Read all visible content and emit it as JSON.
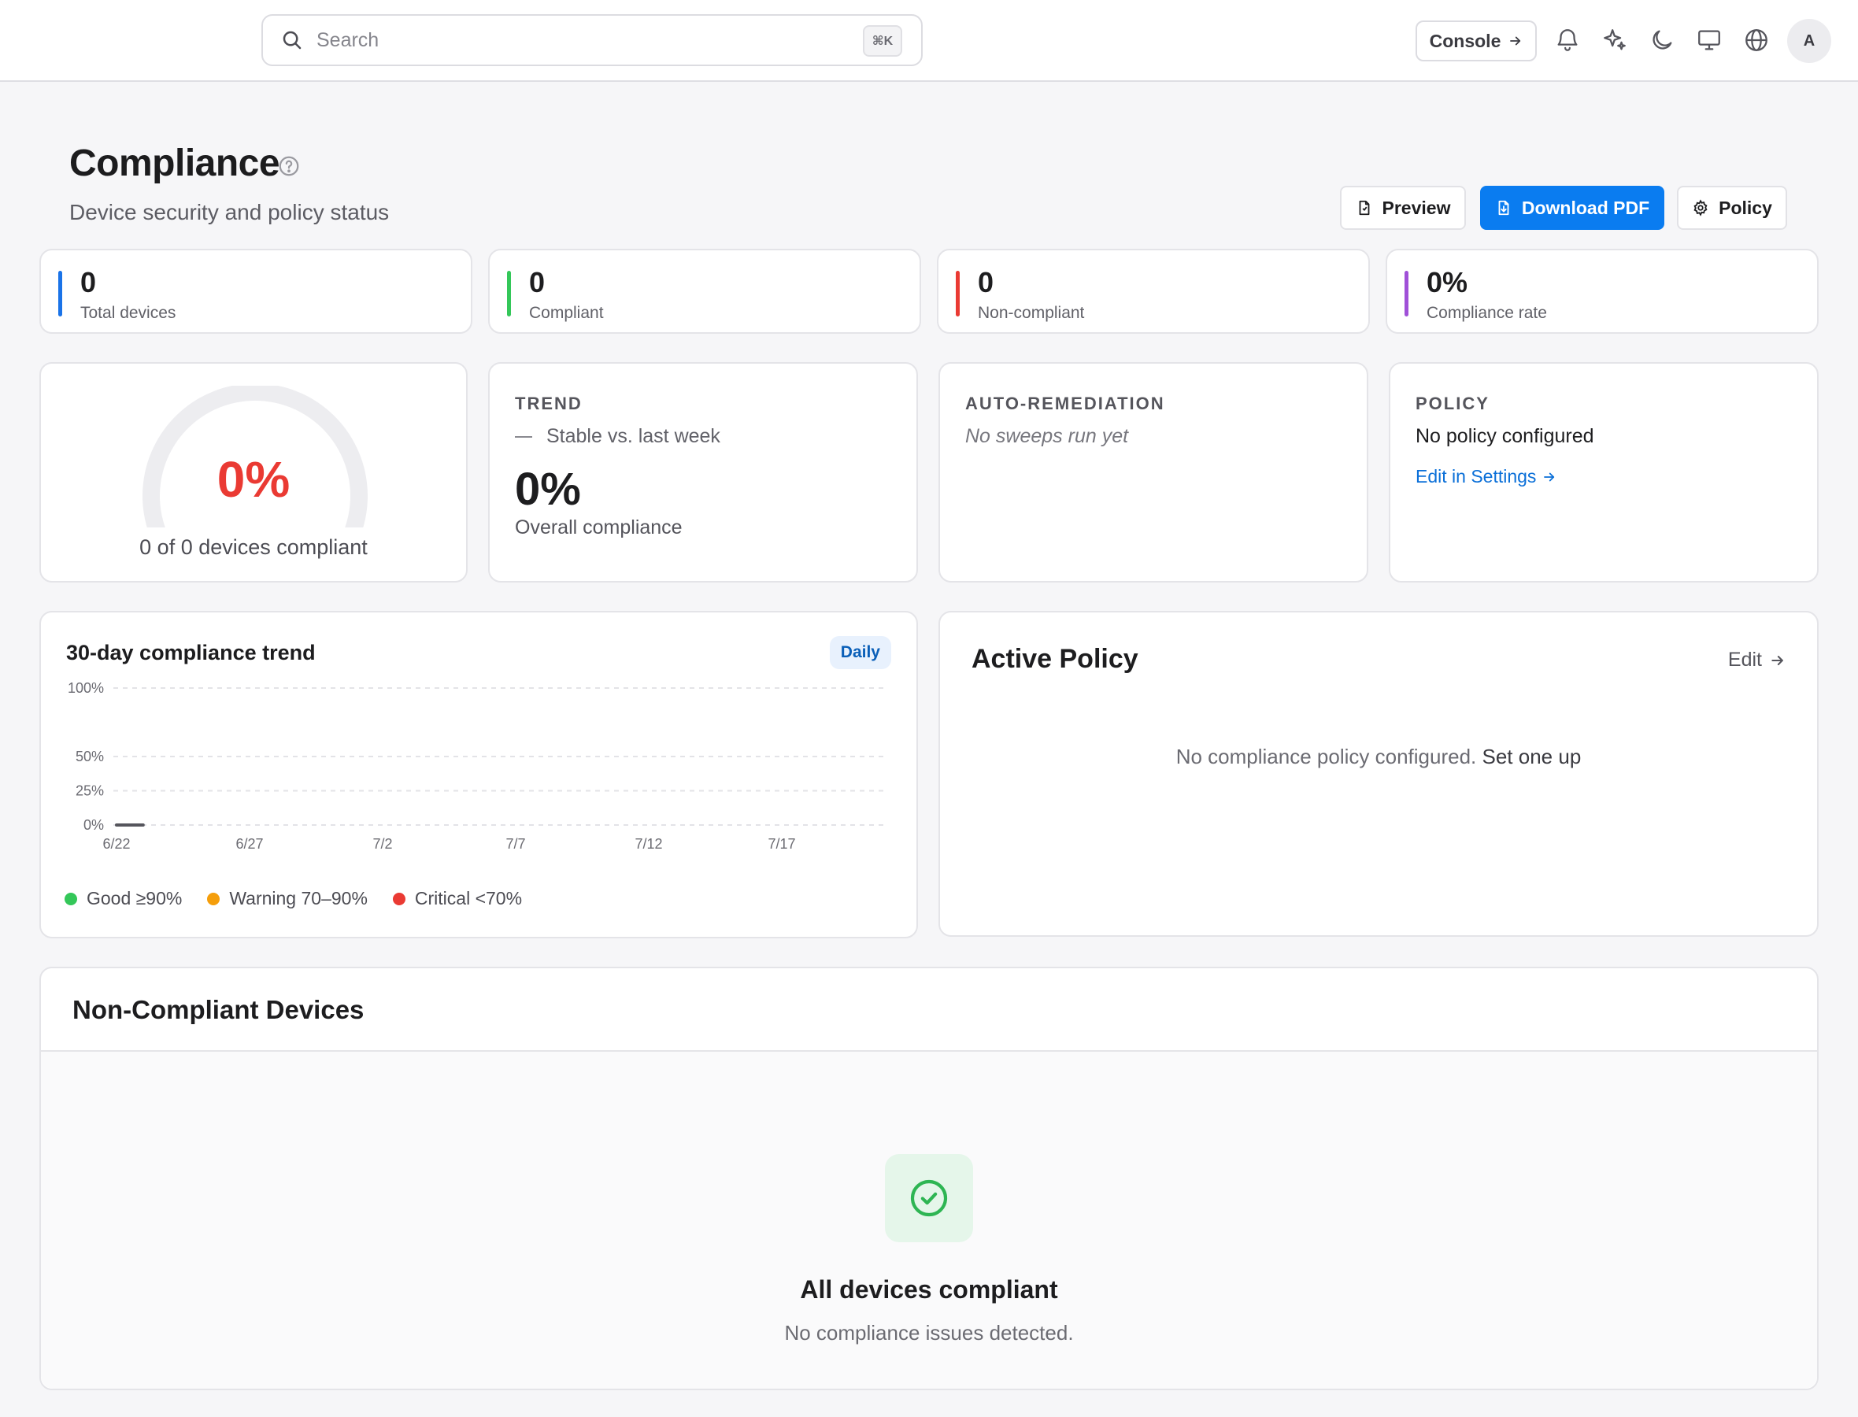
{
  "topbar": {
    "search_placeholder": "Search",
    "search_shortcut": "⌘K",
    "console_label": "Console",
    "avatar_initial": "A"
  },
  "header": {
    "title": "Compliance",
    "subtitle": "Device security and policy status",
    "preview_label": "Preview",
    "download_label": "Download PDF",
    "policy_label": "Policy"
  },
  "stats": [
    {
      "value": "0",
      "label": "Total devices",
      "color": "#1a73e8"
    },
    {
      "value": "0",
      "label": "Compliant",
      "color": "#34c759"
    },
    {
      "value": "0",
      "label": "Non-compliant",
      "color": "#ea3a33"
    },
    {
      "value": "0%",
      "label": "Compliance rate",
      "color": "#a050d8"
    }
  ],
  "gauge": {
    "percent_text": "0%",
    "value_fraction": 0,
    "caption": "0 of 0 devices compliant",
    "track_color": "#ededf0",
    "value_color": "#ea3a33"
  },
  "trend": {
    "kicker": "TREND",
    "change": "Stable vs. last week",
    "value": "0%",
    "caption": "Overall compliance"
  },
  "remediation": {
    "kicker": "AUTO-REMEDIATION",
    "note": "No sweeps run yet"
  },
  "policy_card": {
    "kicker": "POLICY",
    "status": "No policy configured",
    "link": "Edit in Settings"
  },
  "chart_card": {
    "title": "30-day compliance trend",
    "badge": "Daily",
    "legend": [
      {
        "label": "Good ≥90%",
        "color": "#34c759"
      },
      {
        "label": "Warning 70–90%",
        "color": "#f59e0b"
      },
      {
        "label": "Critical <70%",
        "color": "#ea3a33"
      }
    ]
  },
  "chart_data": {
    "type": "line",
    "x": [
      "6/22",
      "6/23"
    ],
    "series": [
      {
        "values": [
          0,
          0
        ]
      }
    ],
    "x_tick_labels": [
      "6/22",
      "6/27",
      "7/2",
      "7/7",
      "7/12",
      "7/17"
    ],
    "y_tick_labels": [
      "100%",
      "50%",
      "25%",
      "0%"
    ],
    "y_ticks": [
      100,
      50,
      25,
      0
    ],
    "ylim": [
      0,
      100
    ],
    "grid": true,
    "legend": "bottom-left"
  },
  "active_policy": {
    "title": "Active Policy",
    "edit_label": "Edit",
    "empty_text": "No compliance policy configured.",
    "setup_link": "Set one up"
  },
  "non_compliant": {
    "title": "Non-Compliant Devices",
    "empty_title": "All devices compliant",
    "empty_sub": "No compliance issues detected."
  }
}
